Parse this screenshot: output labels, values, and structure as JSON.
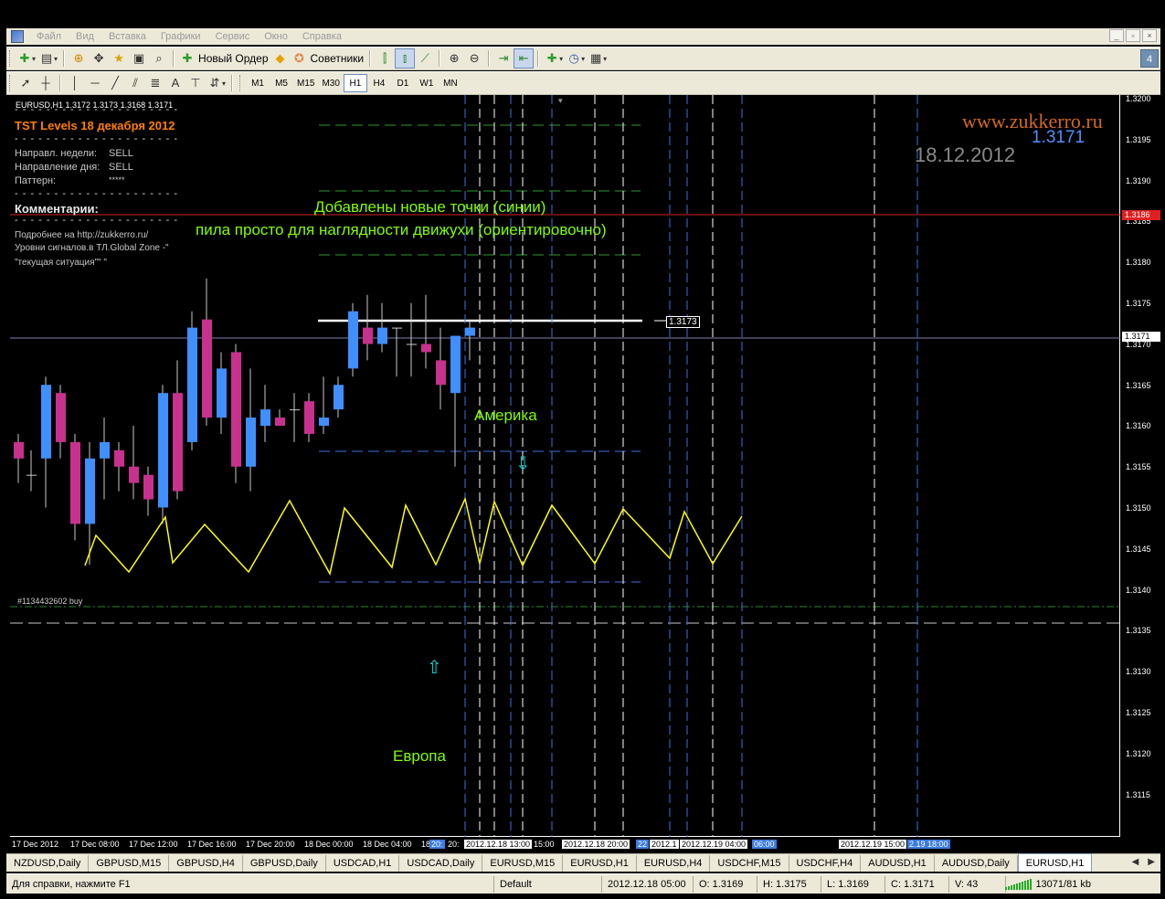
{
  "menu": {
    "items": [
      "Файл",
      "Вид",
      "Вставка",
      "Графики",
      "Сервис",
      "Окно",
      "Справка"
    ],
    "window_buttons": [
      "_",
      "▫",
      "×"
    ]
  },
  "toolbar1": {
    "new_order": "Новый Ордер",
    "advisors": "Советники",
    "notify_count": "4"
  },
  "toolbar2": {
    "timeframes": [
      "M1",
      "M5",
      "M15",
      "M30",
      "H1",
      "H4",
      "D1",
      "W1",
      "MN"
    ],
    "active_tf": "H1"
  },
  "chart": {
    "symbol_header": "EURUSD,H1  1.3172 1.3173 1.3168 1.3171",
    "title": "TST Levels   18 декабря 2012",
    "dash": "- - - - - - - - - - - - - - - - - - - - -",
    "week_dir_label": "Направл. недели:",
    "week_dir_value": "SELL",
    "day_dir_label": "Направление дня:",
    "day_dir_value": "SELL",
    "pattern_label": "Паттерн:",
    "pattern_value": "*****",
    "comments_label": "Комментарии:",
    "comment_line1": "Подробнее на http://zukkerro.ru/",
    "comment_line1b": "Уровни сигналов.в ТЛ.Global Zone -\"",
    "comment_line2": "\"текущая ситуация\"\" \"",
    "site": "www.zukkerro.ru",
    "big_price": "1.3171",
    "big_date": "18.12.2012",
    "note1": "Добавлены новые точки (синии)",
    "note2": "пила просто для наглядности движухи (ориентировочно)",
    "america": "Америка",
    "europe": "Европа",
    "order_label": "#1134432602 buy",
    "line_price": "1.3173",
    "bid_tag": "1.3171",
    "red_tag": "1.3186"
  },
  "y_axis": {
    "ticks": [
      "1.3200",
      "1.3195",
      "1.3190",
      "1.3185",
      "1.3180",
      "1.3175",
      "1.3170",
      "1.3165",
      "1.3160",
      "1.3155",
      "1.3150",
      "1.3145",
      "1.3140",
      "1.3135",
      "1.3130",
      "1.3125",
      "1.3120",
      "1.3115"
    ]
  },
  "x_axis": {
    "labels": [
      "17 Dec 2012",
      "17 Dec 08:00",
      "17 Dec 12:00",
      "17 Dec 16:00",
      "17 Dec 20:00",
      "18 Dec 00:00",
      "18 Dec 04:00",
      "18"
    ],
    "extra": [
      "20:",
      "20:",
      "2012.12.18 13:00",
      "15:00",
      "2012.12.18 20:00",
      "22",
      "2012.1",
      "2012.12.19 04:00",
      "06:00",
      "2012.12.19 15:00",
      "2.19 18:00"
    ]
  },
  "tabs": {
    "items": [
      "NZDUSD,Daily",
      "GBPUSD,M15",
      "GBPUSD,H4",
      "GBPUSD,Daily",
      "USDCAD,H1",
      "USDCAD,Daily",
      "EURUSD,M15",
      "EURUSD,H1",
      "EURUSD,H4",
      "USDCHF,M15",
      "USDCHF,H4",
      "AUDUSD,H1",
      "AUDUSD,Daily",
      "EURUSD,H1"
    ],
    "active_index": 13
  },
  "status": {
    "help": "Для справки, нажмите F1",
    "profile": "Default",
    "datetime": "2012.12.18 05:00",
    "open": "O: 1.3169",
    "high": "H: 1.3175",
    "low": "L: 1.3169",
    "close": "C: 1.3171",
    "volume": "V: 43",
    "traffic": "13071/81 kb"
  },
  "colors": {
    "bull": "#3f8fff",
    "bear": "#c8318e",
    "zigzag": "#ffff00",
    "note_green": "#80ff00",
    "site_orange": "#d2691e"
  }
}
